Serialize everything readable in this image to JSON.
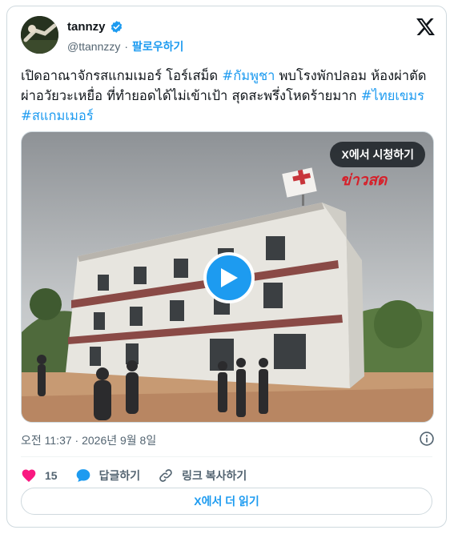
{
  "author": {
    "name": "tannzy",
    "handle": "@ttannzzy",
    "follow_label": "팔로우하기",
    "separator": "·"
  },
  "tweet": {
    "segments": [
      {
        "text": "เปิดอาณาจักรสแกมเมอร์ โอร์เสม็ด ",
        "hashtag": false
      },
      {
        "text": "#กัมพูชา",
        "hashtag": true
      },
      {
        "text": " พบโรงพักปลอม ห้องผ่าตัด ผ่าอวัยวะเหยื่อ ที่ทำยอดได้ไม่เข้าเป้า สุดสะพรึ่งโหดร้ายมาก ",
        "hashtag": false
      },
      {
        "text": "#ไทยเขมร",
        "hashtag": true
      },
      {
        "text": " ",
        "hashtag": false
      },
      {
        "text": "#สแกมเมอร์",
        "hashtag": true
      }
    ]
  },
  "media": {
    "watch_label": "X에서 시청하기",
    "overlay_text": "ข่าวสด"
  },
  "meta": {
    "timestamp": "오전 11:37 · 2026년 9월 8일"
  },
  "actions": {
    "like_count": "15",
    "reply_label": "답글하기",
    "copy_link_label": "링크 복사하기"
  },
  "read_more_label": "X에서 더 읽기",
  "colors": {
    "accent": "#1d9bf0",
    "like": "#f91880",
    "text": "#0f1419",
    "muted": "#536471"
  }
}
